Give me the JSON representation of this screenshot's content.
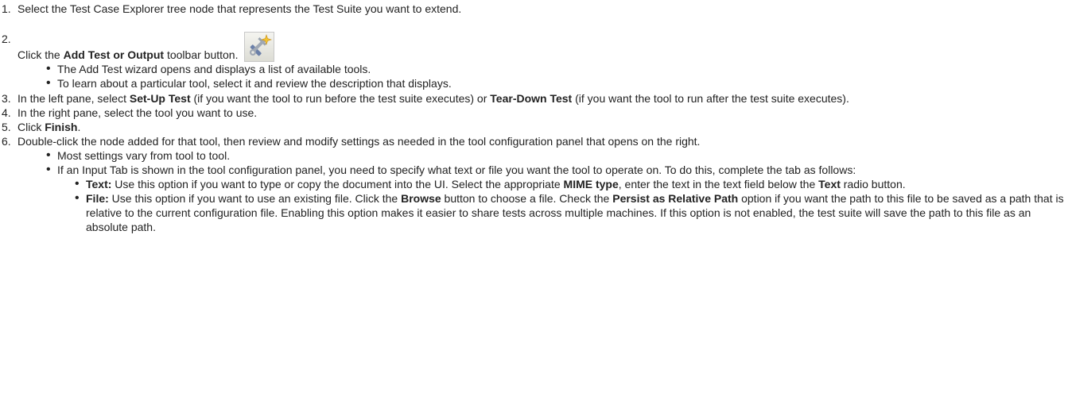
{
  "steps": [
    {
      "num": "1.",
      "text": "Select the Test Case Explorer tree node that represents the Test Suite you want to extend."
    },
    {
      "num": "2.",
      "pre": "Click the ",
      "bold": "Add Test or Output",
      "post": " toolbar button.",
      "icon": "add-test-toolbar-icon",
      "bullets": [
        "The Add Test wizard opens and displays a list of available tools.",
        "To learn about a particular tool, select it and review the description that displays."
      ]
    },
    {
      "num": "3.",
      "pre": "In the left pane, select ",
      "bold1": "Set-Up Test",
      "mid": " (if you want the tool to run before the test suite executes) or ",
      "bold2": "Tear-Down Test",
      "post": " (if you want the tool to run after the test suite executes)."
    },
    {
      "num": "4.",
      "text": "In the right pane, select the tool you want to use."
    },
    {
      "num": "5.",
      "pre": "Click ",
      "bold": "Finish",
      "post": "."
    },
    {
      "num": "6.",
      "text": "Double-click the node added for that tool, then review and modify settings as needed in the tool configuration panel that opens on the right.",
      "bullets": [
        "Most settings vary from tool to tool.",
        "If an Input Tab is shown in the tool configuration panel, you need to specify what  text or file  you want the tool to operate on. To do this, complete the tab as follows:"
      ],
      "sub_bullets": {
        "text_item": {
          "label": "Text:",
          "t1": " Use this option if you want to type or copy the document into the UI. Select the appropriate ",
          "b1": "MIME type",
          "t2": ", enter the text in the text field below the ",
          "b2": "Text",
          "t3": " radio button."
        },
        "file_item": {
          "label": "File:",
          "t1": " Use this option if you want to use an existing file. Click the ",
          "b1": "Browse",
          "t2": " button to choose a file. Check the ",
          "b2": "Persist as Relative Path",
          "t3": " option if you want the path to this file to be saved as a path that is relative to the current configuration file. Enabling this option makes it easier to share tests across multiple machines. If this option is not enabled, the test suite will save the path to this file as an absolute path."
        }
      }
    }
  ]
}
